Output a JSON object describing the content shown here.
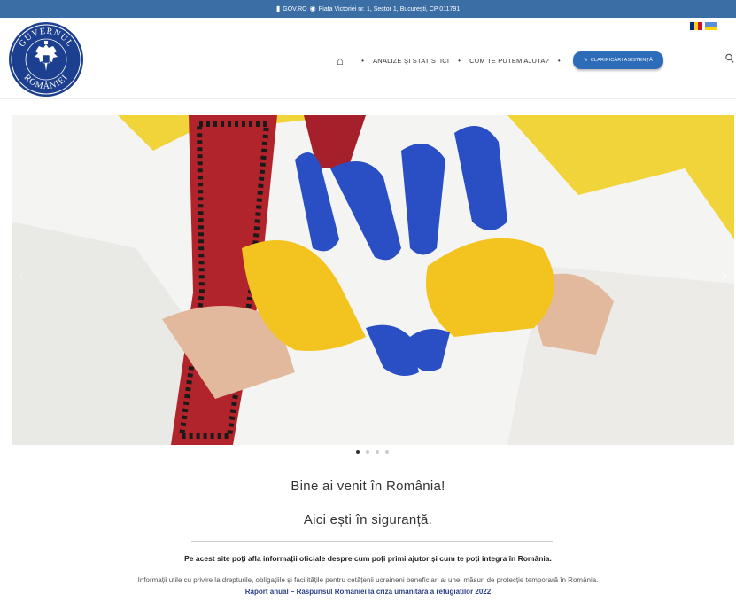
{
  "topbar": {
    "gov_label": "GOV.RO",
    "address": "Piața Victoriei nr. 1, Sector 1, București, CP 011791",
    "icons": [
      "bookmark-icon",
      "map-pin-icon"
    ]
  },
  "header": {
    "logo_text_top": "GUVERNUL",
    "logo_text_bottom": "ROMÂNIEI",
    "languages": [
      "ro-flag",
      "ua-flag"
    ],
    "nav": {
      "home_icon": "home-icon",
      "items": [
        "ANALIZE ȘI STATISTICI",
        "CUM TE PUTEM AJUTA?"
      ],
      "cta_label": "CLARIFICĂRI ASISTENȚĂ",
      "trailing": ".",
      "search_icon": "search-icon"
    }
  },
  "slider": {
    "image_subject": "ukraine-heart-hands",
    "slide_count": 4,
    "active_slide": 1
  },
  "content": {
    "welcome": "Bine ai venit în România!",
    "safe": "Aici ești în siguranță.",
    "lead": "Pe acest site poți afla informații oficiale despre cum poți primi ajutor și cum te poți integra în România.",
    "info": "Informații utile cu privire la drepturile, obligațiile și facilitățile pentru cetățenii ucraineni beneficiari ai unei măsuri de protecție temporară în România.",
    "report_link": "Raport anual – Răspunsul României la criza umanitară a refugiaților 2022"
  },
  "colors": {
    "topbar": "#3a6ea5",
    "cta": "#2d6cb8",
    "link": "#2a3f87",
    "logo": "#1c3f8f"
  }
}
